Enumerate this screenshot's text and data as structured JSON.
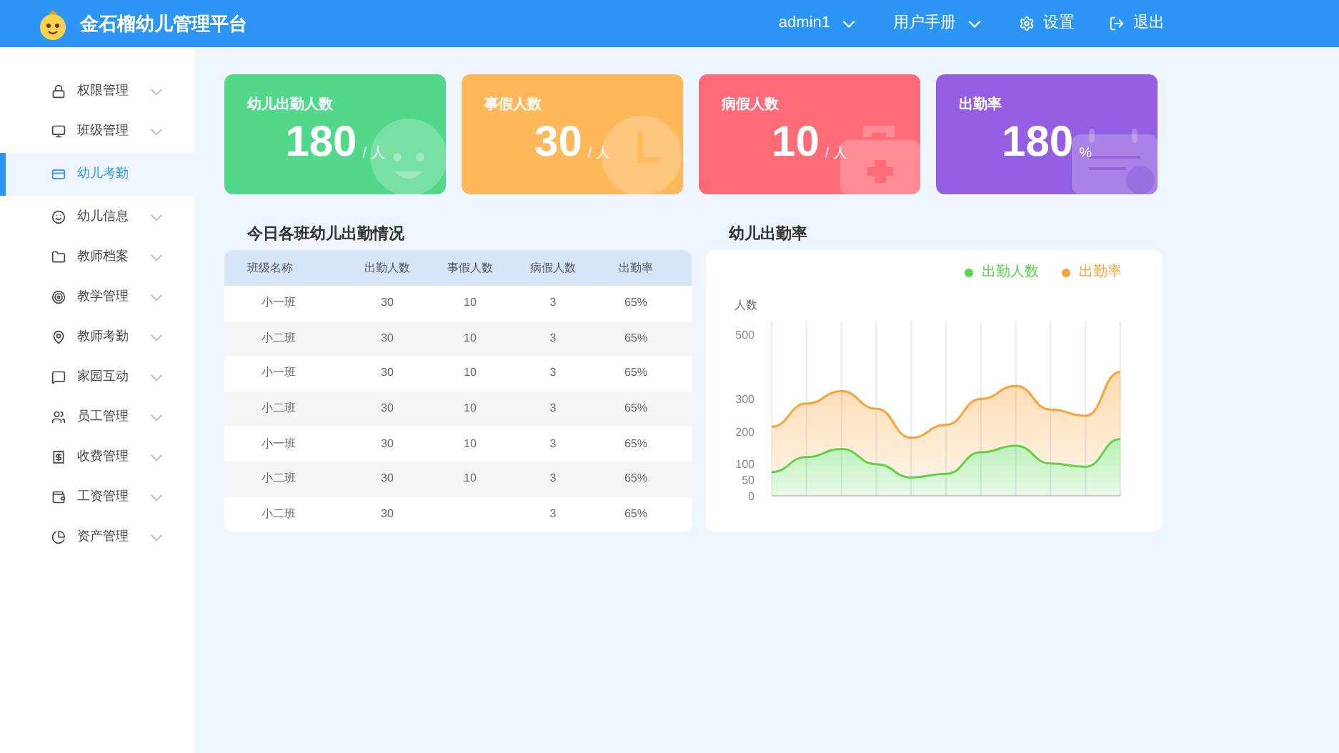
{
  "header": {
    "title": "金石榴幼儿管理平台",
    "menus": [
      {
        "label": "admin1",
        "kind": "dropdown"
      },
      {
        "label": "用户手册",
        "kind": "dropdown"
      },
      {
        "label": "设置",
        "kind": "settings"
      },
      {
        "label": "退出",
        "kind": "logout"
      }
    ]
  },
  "sidebar": {
    "items": [
      {
        "label": "权限管理",
        "selected": false,
        "expandable": true
      },
      {
        "label": "班级管理",
        "selected": false,
        "expandable": true
      },
      {
        "label": "幼儿考勤",
        "selected": true,
        "expandable": false
      },
      {
        "label": "幼儿信息",
        "selected": false,
        "expandable": true
      },
      {
        "label": "教师档案",
        "selected": false,
        "expandable": true
      },
      {
        "label": "教学管理",
        "selected": false,
        "expandable": true
      },
      {
        "label": "教师考勤",
        "selected": false,
        "expandable": true
      },
      {
        "label": "家园互动",
        "selected": false,
        "expandable": true
      },
      {
        "label": "员工管理",
        "selected": false,
        "expandable": true
      },
      {
        "label": "收费管理",
        "selected": false,
        "expandable": true
      },
      {
        "label": "工资管理",
        "selected": false,
        "expandable": true
      },
      {
        "label": "资产管理",
        "selected": false,
        "expandable": true
      }
    ]
  },
  "stat_cards": [
    {
      "title": "幼儿出勤人数",
      "value": "180",
      "unit": "/ 人",
      "color": "#52d88a",
      "kind": "child"
    },
    {
      "title": "事假人数",
      "value": "30",
      "unit": "/ 人",
      "color": "#ffb859",
      "kind": "clock"
    },
    {
      "title": "病假人数",
      "value": "10",
      "unit": "/ 人",
      "color": "#ff6b78",
      "kind": "medkit"
    },
    {
      "title": "出勤率",
      "value": "180",
      "unit": "%",
      "color": "#945ee2",
      "kind": "calendar"
    }
  ],
  "attendance_table": {
    "title": "今日各班幼儿出勤情况",
    "columns": [
      "班级名称",
      "出勤人数",
      "事假人数",
      "病假人数",
      "出勤率"
    ],
    "rows": [
      [
        "小一班",
        "30",
        "10",
        "3",
        "65%"
      ],
      [
        "小二班",
        "30",
        "10",
        "3",
        "65%"
      ],
      [
        "小一班",
        "30",
        "10",
        "3",
        "65%"
      ],
      [
        "小二班",
        "30",
        "10",
        "3",
        "65%"
      ],
      [
        "小一班",
        "30",
        "10",
        "3",
        "65%"
      ],
      [
        "小二班",
        "30",
        "10",
        "3",
        "65%"
      ],
      [
        "小二班",
        "30",
        "",
        "3",
        "65%"
      ]
    ]
  },
  "rate_chart": {
    "title": "幼儿出勤率",
    "chart_data": {
      "type": "area",
      "ylabel": "人数",
      "ylim": [
        0,
        540
      ],
      "yticks": [
        0,
        50,
        100,
        200,
        300,
        500
      ],
      "grid": true,
      "legend": true,
      "series": [
        {
          "name": "出勤人数",
          "color": "#52d64a",
          "values": [
            74,
            120,
            145,
            98,
            57,
            68,
            135,
            155,
            100,
            90,
            176
          ]
        },
        {
          "name": "出勤率",
          "color": "#f9a237",
          "values": [
            214,
            286,
            324,
            270,
            180,
            220,
            300,
            340,
            267,
            248,
            384
          ]
        }
      ]
    }
  }
}
